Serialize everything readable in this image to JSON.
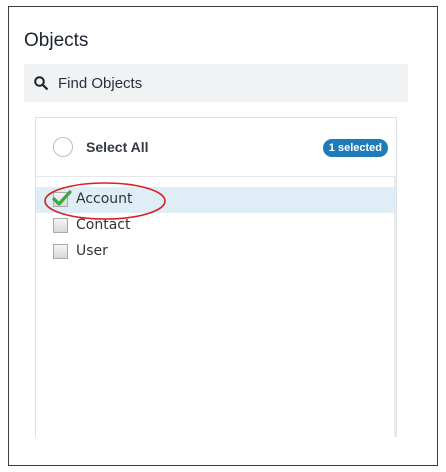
{
  "panel": {
    "title": "Objects"
  },
  "search": {
    "placeholder": "Find Objects",
    "icon": "search-icon"
  },
  "list": {
    "select_all_label": "Select All",
    "selected_badge": "1 selected",
    "items": [
      {
        "label": "Account",
        "checked": true,
        "highlighted": true
      },
      {
        "label": "Contact",
        "checked": false,
        "highlighted": false
      },
      {
        "label": "User",
        "checked": false,
        "highlighted": false
      }
    ]
  },
  "colors": {
    "badge": "#1f7bb8",
    "highlight_row": "#dfedf6",
    "check_green": "#3aa83a",
    "annotation_red": "#d62222"
  }
}
